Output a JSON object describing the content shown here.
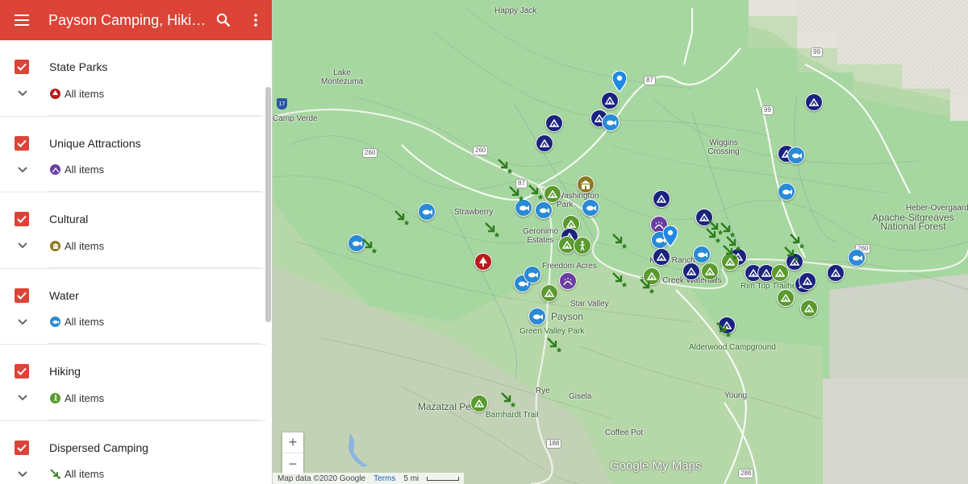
{
  "appbar": {
    "title": "Payson Camping, Hiking, & Attractions",
    "menu_icon": "menu-icon",
    "search_icon": "search-icon",
    "more_icon": "more-vert-icon"
  },
  "layers": [
    {
      "name": "State Parks",
      "all_items": "All items",
      "color": "#b71c1c",
      "icon": "tree-icon"
    },
    {
      "name": "Unique Attractions",
      "all_items": "All items",
      "color": "#6a3fa0",
      "icon": "sparkle-icon"
    },
    {
      "name": "Cultural",
      "all_items": "All items",
      "color": "#8d7a1e",
      "icon": "museum-icon"
    },
    {
      "name": "Water",
      "all_items": "All items",
      "color": "#2a8ad4",
      "icon": "fish-icon"
    },
    {
      "name": "Hiking",
      "all_items": "All items",
      "color": "#5a9a2e",
      "icon": "hiker-icon"
    },
    {
      "name": "Dispersed Camping",
      "all_items": "All items",
      "color": "#3a8a2a",
      "icon": "arrow-icon"
    }
  ],
  "map": {
    "places": [
      "Happy Jack",
      "Lake Montezuma",
      "Camp Verde",
      "Strawberry",
      "Geronimo Estates",
      "Washington Park",
      "Freedom Acres",
      "Kohls Ranch",
      "Tonto Creek Waterfalls",
      "Star Valley",
      "Payson",
      "Green Valley Park",
      "Wiggins Crossing",
      "Rim Top Trailhead",
      "Alderwood Campground",
      "Heber-Overgaard",
      "Apache-Sitgreaves National Forest",
      "Mazatzal Peak",
      "Barnhardt Trail",
      "Rye",
      "Gisela",
      "Young",
      "Coffee Pot"
    ],
    "routes": [
      "87",
      "260",
      "99",
      "17",
      "188",
      "288"
    ],
    "zoom_in": "+",
    "zoom_out": "−",
    "brand": "Google My Maps",
    "attribution": "Map data ©2020 Google",
    "terms": "Terms",
    "scale": "5 mi"
  },
  "colors": {
    "header": "#db4437",
    "campground": "#1a237e",
    "water": "#2a8ad4",
    "hiking": "#5a9a2e",
    "dispersed": "#3a9a2a"
  }
}
